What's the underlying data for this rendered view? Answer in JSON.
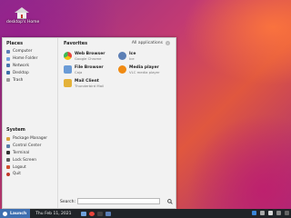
{
  "desktop": {
    "home_label": "desktop's Home"
  },
  "menu": {
    "places_header": "Places",
    "places": [
      {
        "label": "Computer",
        "icon": "computer-icon",
        "color": "#5b7fb8"
      },
      {
        "label": "Home Folder",
        "icon": "home-folder-icon",
        "color": "#6fa2dc"
      },
      {
        "label": "Network",
        "icon": "network-icon",
        "color": "#4a76ad"
      },
      {
        "label": "Desktop",
        "icon": "desktop-icon",
        "color": "#3d6fa8"
      },
      {
        "label": "Trash",
        "icon": "trash-icon",
        "color": "#9a9a9a"
      }
    ],
    "system_header": "System",
    "system": [
      {
        "label": "Package Manager",
        "icon": "package-manager-icon",
        "color": "#d8a03c"
      },
      {
        "label": "Control Center",
        "icon": "control-center-icon",
        "color": "#5a7ea8"
      },
      {
        "label": "Terminal",
        "icon": "terminal-icon",
        "color": "#333333"
      },
      {
        "label": "Lock Screen",
        "icon": "lock-screen-icon",
        "color": "#5e5e5e"
      },
      {
        "label": "Logout",
        "icon": "logout-icon",
        "color": "#d0502e"
      },
      {
        "label": "Quit",
        "icon": "quit-icon",
        "color": "#c0392b"
      }
    ],
    "favorites_header": "Favorites",
    "all_apps_label": "All applications",
    "favorites": [
      {
        "name": "Web Browser",
        "desc": "Google Chrome",
        "icon": "chrome-icon",
        "color": "#e8453c"
      },
      {
        "name": "Ice",
        "desc": "Ice",
        "icon": "ice-icon",
        "color": "#5c7fb5"
      },
      {
        "name": "File Browser",
        "desc": "Caja",
        "icon": "file-browser-icon",
        "color": "#6a9bd6"
      },
      {
        "name": "Media player",
        "desc": "VLC media player",
        "icon": "vlc-icon",
        "color": "#f08a12"
      },
      {
        "name": "Mail Client",
        "desc": "Thunderbird Mail",
        "icon": "mail-icon",
        "color": "#e4b23a"
      }
    ],
    "search_label": "Search:",
    "search_value": ""
  },
  "taskbar": {
    "launch_label": "Launch",
    "date": "Thu Feb 11, 2021"
  }
}
